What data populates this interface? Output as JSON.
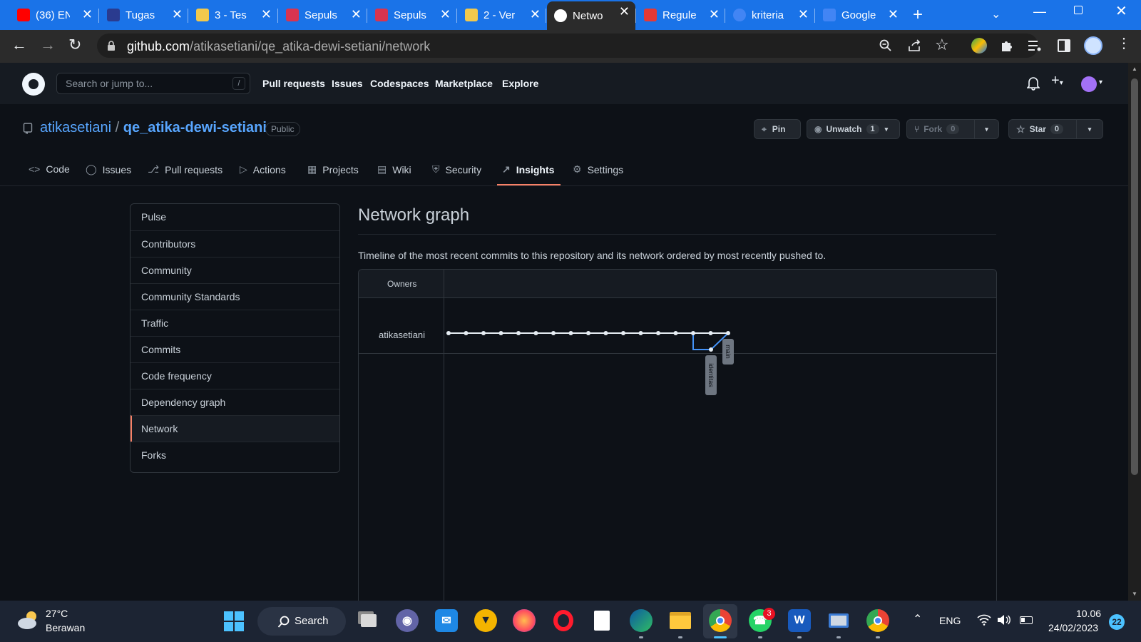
{
  "browser": {
    "tabs": [
      {
        "label": "(36) EN",
        "icon": "youtube-icon",
        "color": "#ff0000"
      },
      {
        "label": "Tugas",
        "icon": "site-icon",
        "color": "#2a3b8f"
      },
      {
        "label": "3 - Tes",
        "icon": "notes-icon",
        "color": "#f2c94c"
      },
      {
        "label": "Sepuls",
        "icon": "sepulsa-icon",
        "color": "#d8344f"
      },
      {
        "label": "Sepuls",
        "icon": "sepulsa-icon",
        "color": "#d8344f"
      },
      {
        "label": "2 - Ver",
        "icon": "notes-icon",
        "color": "#f2c94c"
      },
      {
        "label": "Netwo",
        "icon": "github-icon",
        "color": "#ffffff"
      },
      {
        "label": "Regule",
        "icon": "blood-drop-icon",
        "color": "#e53935"
      },
      {
        "label": "kriteria",
        "icon": "google-icon",
        "color": "#4285f4"
      },
      {
        "label": "Google",
        "icon": "google-translate-icon",
        "color": "#4285f4"
      }
    ],
    "url_host": "github.com",
    "url_path": "/atikasetiani/qe_atika-dewi-setiani/network"
  },
  "gh_header": {
    "search_placeholder": "Search or jump to...",
    "slash": "/",
    "nav": [
      "Pull requests",
      "Issues",
      "Codespaces",
      "Marketplace",
      "Explore"
    ]
  },
  "repo": {
    "owner": "atikasetiani",
    "separator": "/",
    "name": "qe_atika-dewi-setiani",
    "visibility": "Public",
    "pin_label": "Pin",
    "watch_label": "Unwatch",
    "watch_count": "1",
    "fork_label": "Fork",
    "fork_count": "0",
    "star_label": "Star",
    "star_count": "0"
  },
  "repo_nav": [
    {
      "label": "Code",
      "icon": "code-icon"
    },
    {
      "label": "Issues",
      "icon": "issue-icon"
    },
    {
      "label": "Pull requests",
      "icon": "pull-request-icon"
    },
    {
      "label": "Actions",
      "icon": "actions-icon"
    },
    {
      "label": "Projects",
      "icon": "projects-icon"
    },
    {
      "label": "Wiki",
      "icon": "wiki-icon"
    },
    {
      "label": "Security",
      "icon": "shield-icon"
    },
    {
      "label": "Insights",
      "icon": "graph-icon",
      "selected": true
    },
    {
      "label": "Settings",
      "icon": "gear-icon"
    }
  ],
  "sidebar": {
    "items": [
      "Pulse",
      "Contributors",
      "Community",
      "Community Standards",
      "Traffic",
      "Commits",
      "Code frequency",
      "Dependency graph",
      "Network",
      "Forks"
    ],
    "selected": "Network"
  },
  "main": {
    "title": "Network graph",
    "description": "Timeline of the most recent commits to this repository and its network ordered by most recently pushed to.",
    "owners_header": "Owners",
    "owner_row": "atikasetiani",
    "branch_labels": [
      "main",
      "identitas"
    ],
    "main_commit_count": 17,
    "colors": {
      "line": "#e6edf3",
      "branch": "#4493f8",
      "label_bg": "#6e7681"
    }
  },
  "taskbar": {
    "weather_temp": "27°C",
    "weather_desc": "Berawan",
    "search_label": "Search",
    "language": "ENG",
    "time": "10.06",
    "date": "24/02/2023",
    "notification_count": "22",
    "whatsapp_badge": "3"
  }
}
